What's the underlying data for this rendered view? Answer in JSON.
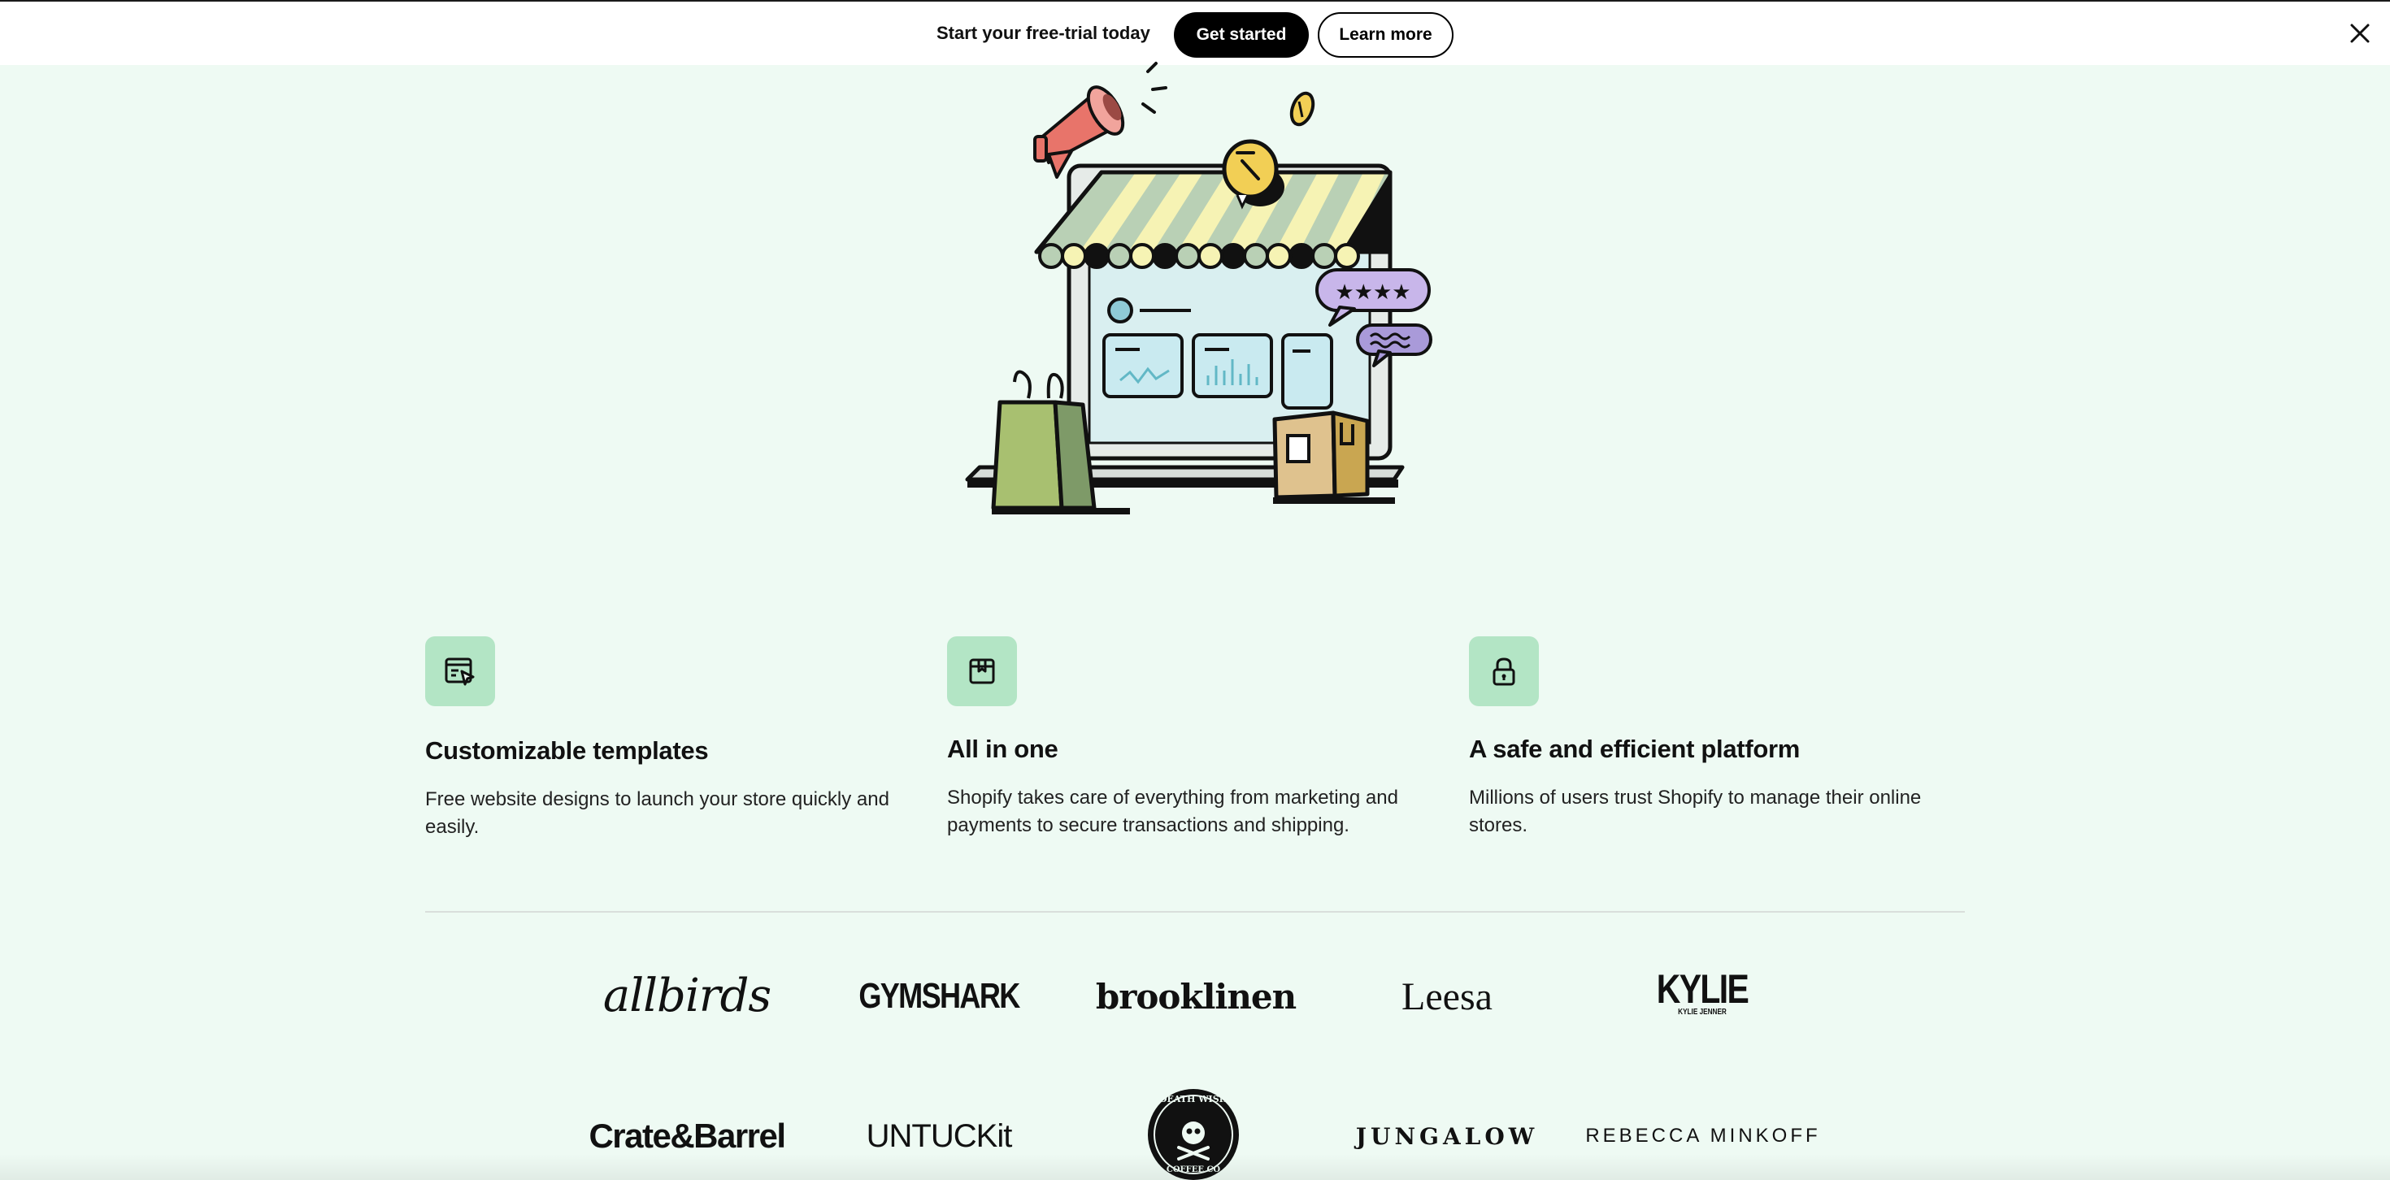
{
  "banner": {
    "promo_text": "Start your free-trial today",
    "primary_label": "Get started",
    "secondary_label": "Learn more",
    "close_icon": "close-icon"
  },
  "hero": {
    "illustration": "online-storefront-illustration",
    "rating_stars": "★★★★"
  },
  "features": [
    {
      "icon": "template-cursor-icon",
      "title": "Customizable templates",
      "description": "Free website designs to launch your store quickly and easily."
    },
    {
      "icon": "store-bag-icon",
      "title": "All in one",
      "description": "Shopify takes care of everything from marketing and payments to secure transactions and shipping."
    },
    {
      "icon": "lock-icon",
      "title": "A safe and efficient platform",
      "description": "Millions of users trust Shopify to manage their online stores."
    }
  ],
  "brands": {
    "row1": [
      "allbirds",
      "GYMSHARK",
      "brooklinen",
      "Leesa",
      "KYLIE"
    ],
    "kylie_sub": "KYLIE JENNER",
    "row2": [
      "Crate&Barrel",
      "UNTUCKit",
      "DEATH WISH",
      "JUNGALOW",
      "REBECCA MINKOFF"
    ],
    "deathwish_sub": "COFFEE CO"
  },
  "colors": {
    "background": "#eefaf3",
    "feature_tile": "#b3e5c5",
    "primary_button": "#000000"
  }
}
